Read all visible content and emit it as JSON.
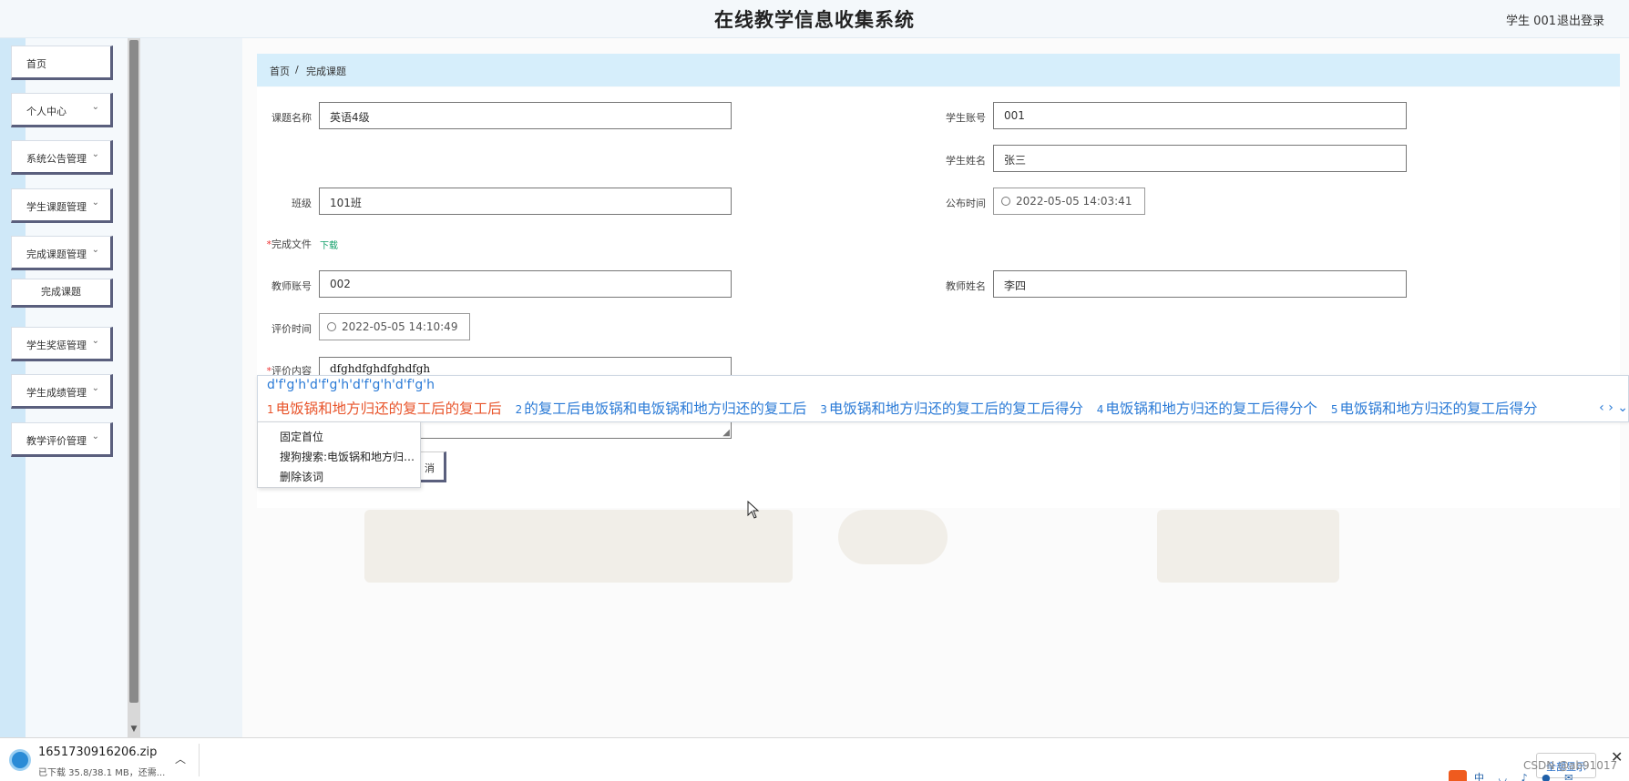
{
  "header": {
    "title": "在线教学信息收集系统",
    "user": "学生 001",
    "logout": "退出登录"
  },
  "sidebar": {
    "items": [
      {
        "label": "首页"
      },
      {
        "label": "个人中心"
      },
      {
        "label": "系统公告管理"
      },
      {
        "label": "学生课题管理"
      },
      {
        "label": "完成课题管理"
      },
      {
        "label": "完成课题"
      },
      {
        "label": "学生奖惩管理"
      },
      {
        "label": "学生成绩管理"
      },
      {
        "label": "教学评价管理"
      }
    ],
    "chevron": "chevron-down-icon"
  },
  "breadcrumb": {
    "home": "首页",
    "separator": "/",
    "current": "完成课题"
  },
  "form": {
    "topic_name": {
      "label": "课题名称",
      "value": "英语4级"
    },
    "student_account": {
      "label": "学生账号",
      "value": "001"
    },
    "student_name": {
      "label": "学生姓名",
      "value": "张三"
    },
    "class_name": {
      "label": "班级",
      "value": "101班"
    },
    "publish_time": {
      "label": "公布时间",
      "value": "2022-05-05 14:03:41"
    },
    "finish_file": {
      "label": "完成文件",
      "required": "*",
      "link": "下载"
    },
    "teacher_account": {
      "label": "教师账号",
      "value": "002"
    },
    "teacher_name": {
      "label": "教师姓名",
      "value": "李四"
    },
    "eval_time": {
      "label": "评价时间",
      "value": "2022-05-05 14:10:49"
    },
    "eval_content": {
      "label": "评价内容",
      "required": "*",
      "value": "dfghdfghdfghdfgh"
    },
    "submit_partial": "消"
  },
  "ime": {
    "composition": "d'f'g'h'd'f'g'h'd'f'g'h'd'f'g'h",
    "candidates": [
      {
        "num": "1",
        "text": "电饭锅和地方归还的复工后的复工后"
      },
      {
        "num": "2",
        "text": "的复工后电饭锅和电饭锅和地方归还的复工后"
      },
      {
        "num": "3",
        "text": "电饭锅和地方归还的复工后的复工后得分"
      },
      {
        "num": "4",
        "text": "电饭锅和地方归还的复工后得分个"
      },
      {
        "num": "5",
        "text": "电饭锅和地方归还的复工后得分"
      }
    ],
    "arrows": "‹ › ⌄"
  },
  "context_menu": {
    "items": [
      "固定首位",
      "搜狗搜索:电饭锅和地方归…",
      "删除该词"
    ]
  },
  "download_bar": {
    "file_name": "1651730916206.zip",
    "status": "已下载 35.8/38.1 MB，还需...",
    "show_all": "全部显示",
    "watermark": "CSDN @ab91017"
  },
  "colors": {
    "accent_blue": "#2a7ad6",
    "active_candidate": "#e8542b",
    "breadcrumb_bg": "#d6eefb",
    "download_link": "#12a06a"
  }
}
